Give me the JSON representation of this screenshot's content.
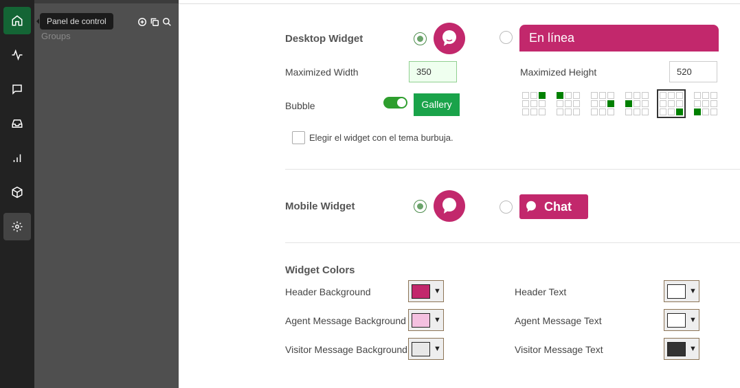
{
  "sidebar": {
    "items": [
      {
        "icon": "home-icon",
        "active": true
      },
      {
        "icon": "activity-icon"
      },
      {
        "icon": "chat-icon"
      },
      {
        "icon": "inbox-icon"
      },
      {
        "icon": "bar-chart-icon"
      },
      {
        "icon": "package-icon"
      },
      {
        "icon": "gear-icon",
        "selected": true
      }
    ],
    "tooltip": "Panel de control"
  },
  "panel": {
    "title": "Groups",
    "tools": [
      "add-circle-icon",
      "copy-icon",
      "search-icon"
    ]
  },
  "desktop": {
    "title": "Desktop Widget",
    "bubble_selected": true,
    "bar_label": "En línea",
    "max_width_label": "Maximized Width",
    "max_width": "350",
    "max_height_label": "Maximized Height",
    "max_height": "520",
    "bubble_label": "Bubble",
    "bubble_on": true,
    "gallery": "Gallery",
    "positions": [
      "top-right",
      "top-left",
      "middle-right",
      "middle-left",
      "bottom-right",
      "bottom-left"
    ],
    "selected_position": "bottom-right",
    "bubble_theme_label": "Elegir el widget con el tema burbuja."
  },
  "mobile": {
    "title": "Mobile Widget",
    "bubble_selected": true,
    "chat_label": "Chat"
  },
  "colors": {
    "title": "Widget Colors",
    "rows": [
      {
        "left": "Header Background",
        "left_color": "#c2286c",
        "right": "Header Text",
        "right_color": "#ffffff"
      },
      {
        "left": "Agent Message Background",
        "left_color": "#f4c0e0",
        "right": "Agent Message Text",
        "right_color": "#ffffff"
      },
      {
        "left": "Visitor Message Background",
        "left_color": "#e8e8e8",
        "right": "Visitor Message Text",
        "right_color": "#333333"
      }
    ]
  },
  "brand": "#c2286c",
  "accent": "#1aa34a"
}
